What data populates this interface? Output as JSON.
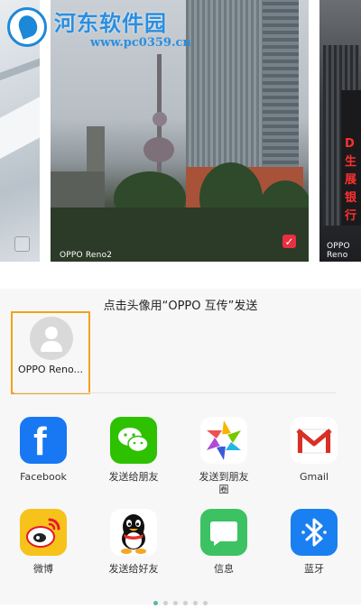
{
  "watermark": {
    "title": "河东软件园",
    "url": "www.pc0359.cn"
  },
  "photos": [
    {
      "label": "",
      "selected": false
    },
    {
      "label": "OPPO Reno2",
      "selected": true
    },
    {
      "label": "OPPO Reno",
      "selected": false
    }
  ],
  "share": {
    "title": "点击头像用“OPPO 互传”发送",
    "device_name": "OPPO Reno...",
    "apps": [
      {
        "label": "Facebook",
        "icon": "facebook-icon"
      },
      {
        "label": "发送给朋友",
        "icon": "wechat-icon"
      },
      {
        "label": "发送到朋友圈",
        "icon": "moments-icon"
      },
      {
        "label": "Gmail",
        "icon": "gmail-icon"
      },
      {
        "label": "微博",
        "icon": "weibo-icon"
      },
      {
        "label": "发送给好友",
        "icon": "qq-icon"
      },
      {
        "label": "信息",
        "icon": "messages-icon"
      },
      {
        "label": "蓝牙",
        "icon": "bluetooth-icon"
      }
    ]
  },
  "pager": {
    "pages": 6,
    "active": 1
  },
  "colors": {
    "accent": "#f2a21c",
    "selected_check": "#e8303f"
  }
}
